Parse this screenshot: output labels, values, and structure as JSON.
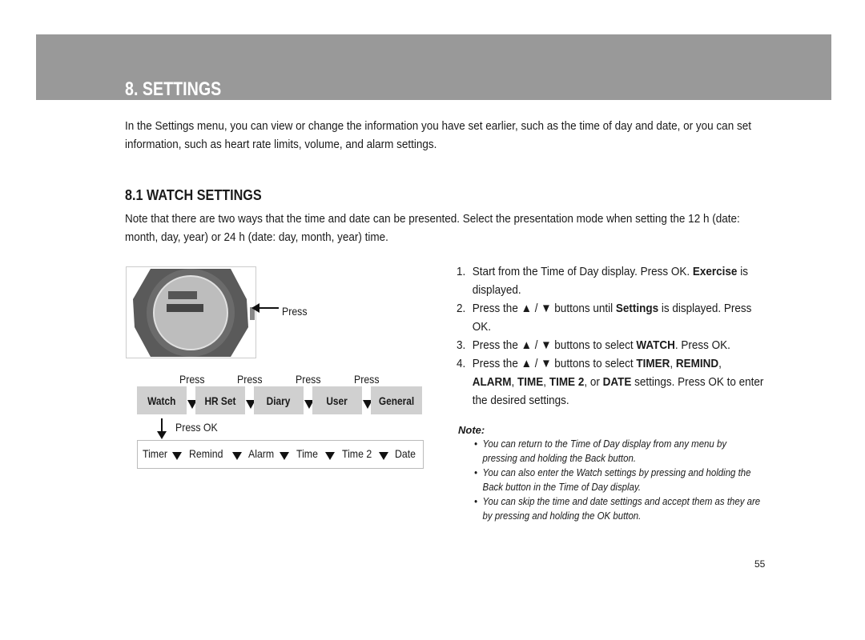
{
  "header": {
    "title": "8. SETTINGS"
  },
  "intro": "In the Settings menu, you can view or change the information you have set earlier, such as the time of day and date, or you can set information, such as heart rate limits, volume, and alarm settings.",
  "section": {
    "title": "8.1  WATCH SETTINGS",
    "description": "Note that there are two ways that the time and date can be presented. Select the presentation mode when setting the 12 h (date: month, day, year) or 24 h (date: day, month, year) time."
  },
  "diagram": {
    "watch_press_label": "Press",
    "press_labels": [
      "Press",
      "Press",
      "Press",
      "Press"
    ],
    "menu_items": [
      "Watch",
      "HR Set",
      "Diary",
      "User",
      "General"
    ],
    "press_ok_label": "Press OK",
    "submenu_items": [
      "Timer",
      "Remind",
      "Alarm",
      "Time",
      "Time 2",
      "Date"
    ]
  },
  "steps": [
    {
      "num": "1.",
      "parts": [
        "Start from the Time of Day display. Press OK. ",
        "Exercise",
        " is displayed."
      ]
    },
    {
      "num": "2.",
      "parts": [
        "Press the ▲ / ▼ buttons until ",
        "Settings",
        " is displayed. Press OK."
      ]
    },
    {
      "num": "3.",
      "parts": [
        "Press the ▲ / ▼ buttons to select ",
        "WATCH",
        ". Press OK."
      ]
    },
    {
      "num": "4.",
      "pre": "Press the ▲ / ▼ buttons to select ",
      "b1": "TIMER",
      "c1": ", ",
      "b2": "REMIND",
      "c2": ", ",
      "b3": "ALARM",
      "c3": ", ",
      "b4": "TIME",
      "c4": ", ",
      "b5": "TIME 2",
      "c5": ", or ",
      "b6": "DATE",
      "post": " settings. Press OK to enter the desired settings."
    }
  ],
  "note": {
    "label": "Note:",
    "bullets": [
      "You can return to the Time of Day display from any menu by pressing and holding the Back button.",
      "You can also enter the Watch settings by pressing and holding the Back button in the Time of Day display.",
      "You can skip the time and date settings and accept them as they are by pressing and holding the OK button."
    ]
  },
  "page_number": "55"
}
